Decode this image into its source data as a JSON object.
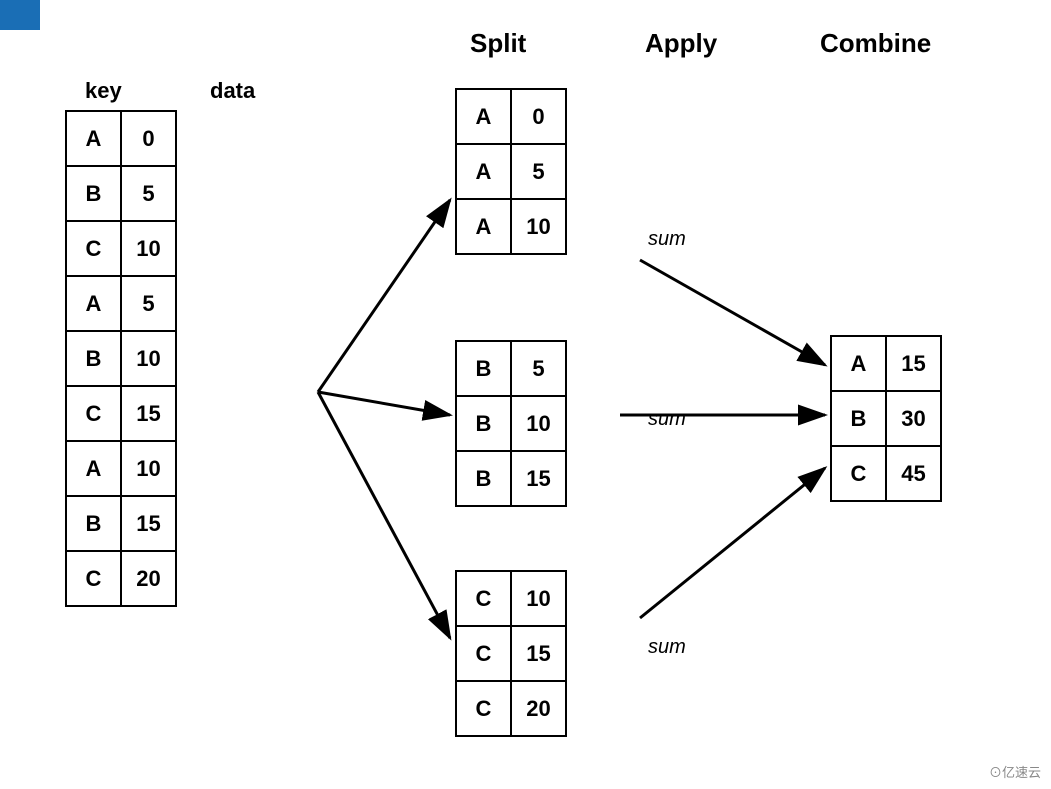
{
  "headers": {
    "split": "Split",
    "apply": "Apply",
    "combine": "Combine"
  },
  "col_headers": {
    "key": "key",
    "data": "data"
  },
  "input_table": {
    "rows": [
      {
        "key": "A",
        "data": "0"
      },
      {
        "key": "B",
        "data": "5"
      },
      {
        "key": "C",
        "data": "10"
      },
      {
        "key": "A",
        "data": "5"
      },
      {
        "key": "B",
        "data": "10"
      },
      {
        "key": "C",
        "data": "15"
      },
      {
        "key": "A",
        "data": "10"
      },
      {
        "key": "B",
        "data": "15"
      },
      {
        "key": "C",
        "data": "20"
      }
    ]
  },
  "split_tables": [
    {
      "id": "A",
      "rows": [
        {
          "key": "A",
          "data": "0"
        },
        {
          "key": "A",
          "data": "5"
        },
        {
          "key": "A",
          "data": "10"
        }
      ]
    },
    {
      "id": "B",
      "rows": [
        {
          "key": "B",
          "data": "5"
        },
        {
          "key": "B",
          "data": "10"
        },
        {
          "key": "B",
          "data": "15"
        }
      ]
    },
    {
      "id": "C",
      "rows": [
        {
          "key": "C",
          "data": "10"
        },
        {
          "key": "C",
          "data": "15"
        },
        {
          "key": "C",
          "data": "20"
        }
      ]
    }
  ],
  "apply_labels": [
    "sum",
    "sum",
    "sum"
  ],
  "combine_table": {
    "rows": [
      {
        "key": "A",
        "data": "15"
      },
      {
        "key": "B",
        "data": "30"
      },
      {
        "key": "C",
        "data": "45"
      }
    ]
  },
  "watermark": "⊙亿速云"
}
